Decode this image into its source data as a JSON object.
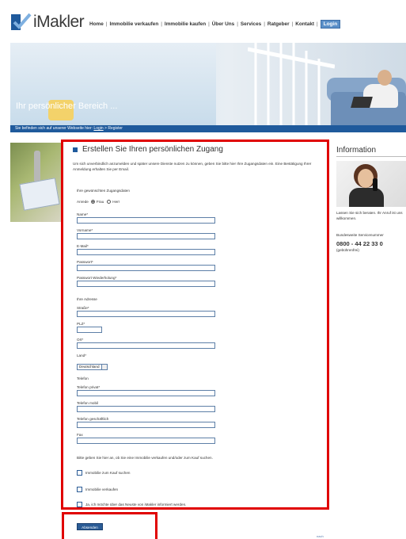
{
  "header": {
    "logo_text": "iMakler",
    "nav": [
      "Home",
      "Immobilie verkaufen",
      "Immobilie kaufen",
      "Über Uns",
      "Services",
      "Ratgeber",
      "Kontakt"
    ],
    "login_label": "Login"
  },
  "hero": {
    "title": "Ihr persönlicher Bereich ...",
    "breadcrumb_prefix": "Sie befinden sich auf unserer Webseite hier:",
    "breadcrumb_link": "Login",
    "breadcrumb_current": "> Register"
  },
  "form": {
    "title": "Erstellen Sie Ihren persönlichen Zugang",
    "intro": "Um sich unverbindlich anzumelden und später unsere Dienste nutzen zu können, geben Sie bitte hier Ihre Zugangsdaten ein. Eine Bestätigung Ihrer Anmeldung erhalten Sie per Email.",
    "section_access": "Ihre gewünschten Zugangsdaten",
    "salutation_label": "Anrede",
    "salutation_options": [
      "Frau",
      "Herr"
    ],
    "fields_access": [
      "Name*",
      "Vorname*",
      "E-Mail*",
      "Passwort*",
      "Passwort Wiederholung*"
    ],
    "section_address": "Ihre Adresse",
    "fields_address": [
      "Straße*",
      "PLZ*",
      "Ort*",
      "Land*"
    ],
    "country_value": "Deutschland",
    "section_phone": "Telefon",
    "fields_phone": [
      "Telefon privat*",
      "Telefon mobil",
      "Telefon geschäftlich",
      "Fax"
    ],
    "interest_prompt": "Bitte geben Sie hier an, ob Sie eine Immobilie verkaufen und/oder zum Kauf suchen.",
    "checkboxes": [
      "Immobilie zum Kauf suchen",
      "Immobilie verkaufen",
      "Ja, ich möchte über das Neuste von iMakler informiert werden."
    ],
    "submit_label": "Absenden"
  },
  "sidebar": {
    "title": "Information",
    "text1": "Lassen Sie sich beraten. Ihr Anruf ist uns willkommen.",
    "text2": "Bundesweite Servicenummer",
    "phone": "0800 - 44 22 33 0",
    "phone_note": "(gebührenfrei)"
  },
  "footer": {
    "corner": "nach"
  }
}
